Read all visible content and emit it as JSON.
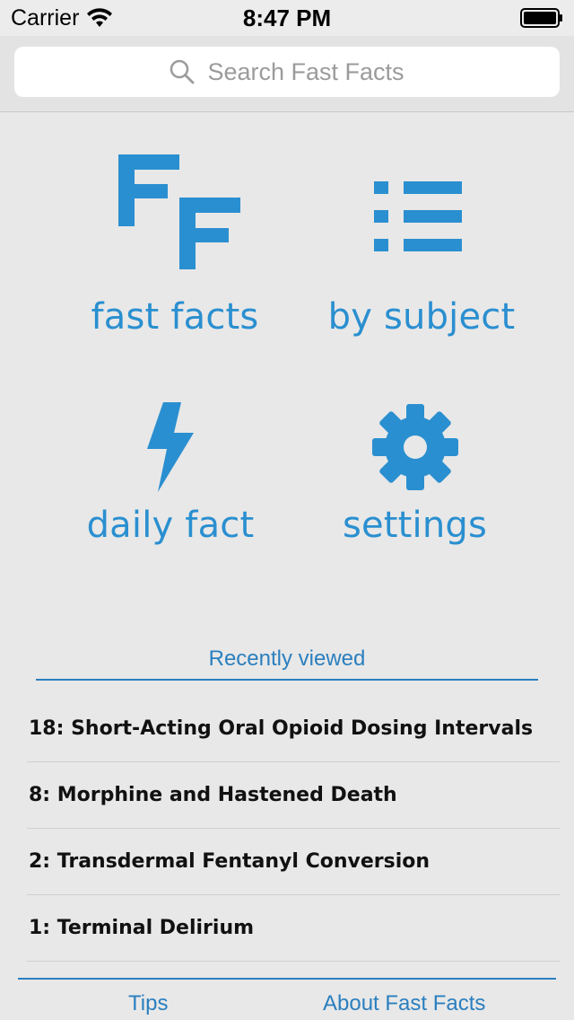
{
  "status_bar": {
    "carrier": "Carrier",
    "time": "8:47 PM"
  },
  "search": {
    "placeholder": "Search Fast Facts"
  },
  "menu": {
    "fast_facts": "fast facts",
    "by_subject": "by subject",
    "daily_fact": "daily fact",
    "settings": "settings"
  },
  "recent": {
    "header": "Recently viewed",
    "items": [
      "18: Short-Acting Oral Opioid Dosing Intervals",
      "8: Morphine and Hastened Death",
      "2: Transdermal Fentanyl Conversion",
      "1: Terminal Delirium"
    ]
  },
  "footer": {
    "tips": "Tips",
    "about": "About Fast Facts"
  },
  "colors": {
    "accent": "#2a8fd0",
    "link": "#2a7fbf",
    "background": "#e8e8e8"
  }
}
